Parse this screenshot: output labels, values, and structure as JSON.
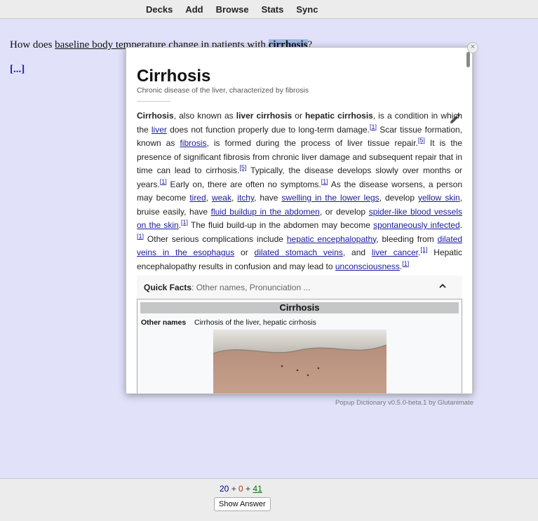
{
  "nav": [
    "Decks",
    "Add",
    "Browse",
    "Stats",
    "Sync"
  ],
  "question": {
    "pre": "How does ",
    "underlined": "baseline body temperature change",
    "mid": " in patients with ",
    "highlight": "cirrhosis",
    "post": "?"
  },
  "cloze": "[...]",
  "popup": {
    "close": "×",
    "title": "Cirrhosis",
    "subtitle": "Chronic disease of the liver, characterized by fibrosis",
    "paragraph": [
      {
        "t": "b",
        "v": "Cirrhosis"
      },
      {
        "t": "s",
        "v": ", also known as "
      },
      {
        "t": "b",
        "v": "liver cirrhosis"
      },
      {
        "t": "s",
        "v": " or "
      },
      {
        "t": "b",
        "v": "hepatic cirrhosis"
      },
      {
        "t": "s",
        "v": ", is a condition in which the "
      },
      {
        "t": "a",
        "v": "liver"
      },
      {
        "t": "s",
        "v": " does not function properly due to long-term damage."
      },
      {
        "t": "sup",
        "v": "[1]"
      },
      {
        "t": "s",
        "v": " Scar tissue formation, known as "
      },
      {
        "t": "a",
        "v": "fibrosis"
      },
      {
        "t": "s",
        "v": ", is formed during the process of liver tissue repair."
      },
      {
        "t": "sup",
        "v": "[5]"
      },
      {
        "t": "s",
        "v": " It is the presence of significant fibrosis from chronic liver damage and subsequent repair that in time can lead to cirrhosis."
      },
      {
        "t": "sup",
        "v": "[5]"
      },
      {
        "t": "s",
        "v": " Typically, the disease develops slowly over months or years."
      },
      {
        "t": "sup",
        "v": "[1]"
      },
      {
        "t": "s",
        "v": " Early on, there are often no symptoms."
      },
      {
        "t": "sup",
        "v": "[1]"
      },
      {
        "t": "s",
        "v": " As the disease worsens, a person may become "
      },
      {
        "t": "a",
        "v": "tired"
      },
      {
        "t": "s",
        "v": ", "
      },
      {
        "t": "a",
        "v": "weak"
      },
      {
        "t": "s",
        "v": ", "
      },
      {
        "t": "a",
        "v": "itchy"
      },
      {
        "t": "s",
        "v": ", have "
      },
      {
        "t": "a",
        "v": "swelling in the lower legs"
      },
      {
        "t": "s",
        "v": ", develop "
      },
      {
        "t": "a",
        "v": "yellow skin"
      },
      {
        "t": "s",
        "v": ", bruise easily, have "
      },
      {
        "t": "a",
        "v": "fluid buildup in the abdomen"
      },
      {
        "t": "s",
        "v": ", or develop "
      },
      {
        "t": "a",
        "v": "spider-like blood vessels on the skin"
      },
      {
        "t": "s",
        "v": "."
      },
      {
        "t": "sup",
        "v": "[1]"
      },
      {
        "t": "s",
        "v": " The fluid build-up in the abdomen may become "
      },
      {
        "t": "a",
        "v": "spontaneously infected"
      },
      {
        "t": "s",
        "v": "."
      },
      {
        "t": "sup",
        "v": "[1]"
      },
      {
        "t": "s",
        "v": " Other serious complications include "
      },
      {
        "t": "a",
        "v": "hepatic encephalopathy"
      },
      {
        "t": "s",
        "v": ", bleeding from "
      },
      {
        "t": "a",
        "v": "dilated veins in the esophagus"
      },
      {
        "t": "s",
        "v": " or "
      },
      {
        "t": "a",
        "v": "dilated stomach veins"
      },
      {
        "t": "s",
        "v": ", and "
      },
      {
        "t": "a",
        "v": "liver cancer"
      },
      {
        "t": "s",
        "v": "."
      },
      {
        "t": "sup",
        "v": "[1]"
      },
      {
        "t": "s",
        "v": " Hepatic encephalopathy results in confusion and may lead to "
      },
      {
        "t": "a",
        "v": "unconsciousness"
      },
      {
        "t": "s",
        "v": "."
      },
      {
        "t": "sup",
        "v": "[1]"
      }
    ],
    "quick_facts_label": "Quick Facts",
    "quick_facts_hint": ": Other names, Pronunciation ...",
    "infobox": {
      "title": "Cirrhosis",
      "label": "Other names",
      "value": "Cirrhosis of the liver, hepatic cirrhosis"
    }
  },
  "credit": "Popup Dictionary v0.5.0-beta.1 by Glutanimate",
  "counts": {
    "new": "20",
    "plus1": " + ",
    "learn": "0",
    "plus2": " + ",
    "review": "41"
  },
  "show_answer": "Show Answer",
  "colors": {
    "card_bg": "#e1e1fa",
    "highlight": "#9fb6e6",
    "link": "#1a1a9e"
  }
}
